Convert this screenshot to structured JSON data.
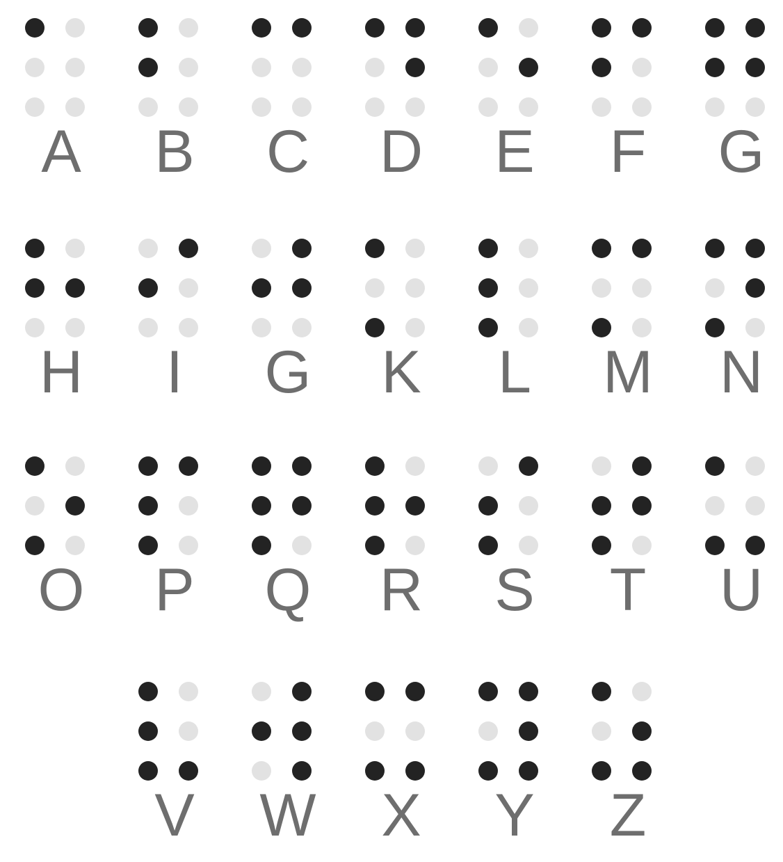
{
  "colors": {
    "raised_dot": "#232323",
    "flat_dot": "#e2e2e2",
    "letter": "#6e6e6e",
    "background": "#ffffff"
  },
  "rows": [
    [
      {
        "letter": "A",
        "dots": [
          1
        ]
      },
      {
        "letter": "B",
        "dots": [
          1,
          2
        ]
      },
      {
        "letter": "C",
        "dots": [
          1,
          4
        ]
      },
      {
        "letter": "D",
        "dots": [
          1,
          4,
          5
        ]
      },
      {
        "letter": "E",
        "dots": [
          1,
          5
        ]
      },
      {
        "letter": "F",
        "dots": [
          1,
          2,
          4
        ]
      },
      {
        "letter": "G",
        "dots": [
          1,
          2,
          4,
          5
        ]
      }
    ],
    [
      {
        "letter": "H",
        "dots": [
          1,
          2,
          5
        ]
      },
      {
        "letter": "I",
        "dots": [
          2,
          4
        ]
      },
      {
        "letter": "G",
        "dots": [
          2,
          4,
          5
        ]
      },
      {
        "letter": "K",
        "dots": [
          1,
          3
        ]
      },
      {
        "letter": "L",
        "dots": [
          1,
          2,
          3
        ]
      },
      {
        "letter": "M",
        "dots": [
          1,
          3,
          4
        ]
      },
      {
        "letter": "N",
        "dots": [
          1,
          3,
          4,
          5
        ]
      }
    ],
    [
      {
        "letter": "O",
        "dots": [
          1,
          3,
          5
        ]
      },
      {
        "letter": "P",
        "dots": [
          1,
          2,
          3,
          4
        ]
      },
      {
        "letter": "Q",
        "dots": [
          1,
          2,
          3,
          4,
          5
        ]
      },
      {
        "letter": "R",
        "dots": [
          1,
          2,
          3,
          5
        ]
      },
      {
        "letter": "S",
        "dots": [
          2,
          3,
          4
        ]
      },
      {
        "letter": "T",
        "dots": [
          2,
          3,
          4,
          5
        ]
      },
      {
        "letter": "U",
        "dots": [
          1,
          3,
          6
        ]
      }
    ],
    [
      {
        "letter": "V",
        "dots": [
          1,
          2,
          3,
          6
        ]
      },
      {
        "letter": "W",
        "dots": [
          2,
          4,
          5,
          6
        ]
      },
      {
        "letter": "X",
        "dots": [
          1,
          3,
          4,
          6
        ]
      },
      {
        "letter": "Y",
        "dots": [
          1,
          3,
          4,
          5,
          6
        ]
      },
      {
        "letter": "Z",
        "dots": [
          1,
          3,
          5,
          6
        ]
      }
    ]
  ]
}
